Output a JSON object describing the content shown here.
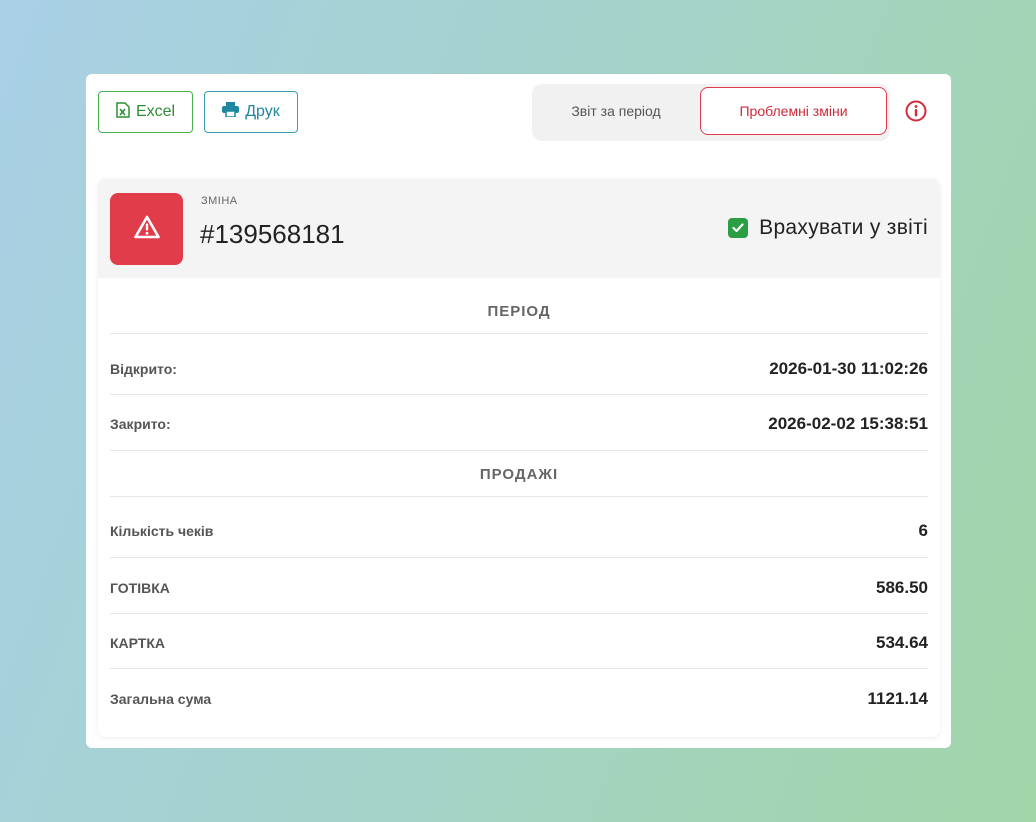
{
  "toolbar": {
    "excel_label": "Excel",
    "print_label": "Друк"
  },
  "tabs": {
    "period_label": "Звіт за період",
    "problem_label": "Проблемні зміни",
    "active": "problem"
  },
  "shift": {
    "caption": "ЗМІНА",
    "id": "#139568181",
    "include_label": "Врахувати у звіті",
    "include_checked": true
  },
  "period": {
    "title": "ПЕРІОД",
    "rows": [
      {
        "label": "Відкрито:",
        "value": "2026-01-30 11:02:26"
      },
      {
        "label": "Закрито:",
        "value": "2026-02-02 15:38:51"
      }
    ]
  },
  "sales": {
    "title": "ПРОДАЖІ",
    "rows": [
      {
        "label": "Кількість чеків",
        "value": "6"
      },
      {
        "label": "ГОТІВКА",
        "value": "586.50"
      },
      {
        "label": "КАРТКА",
        "value": "534.64"
      },
      {
        "label": "Загальна сума",
        "value": "1121.14"
      }
    ]
  },
  "colors": {
    "excel": "#4bb051",
    "print": "#3a9cb2",
    "danger": "#e13c4a",
    "check": "#2a9d45"
  },
  "icons": [
    "excel-icon",
    "printer-icon",
    "info-icon",
    "warning-icon",
    "check-icon"
  ]
}
